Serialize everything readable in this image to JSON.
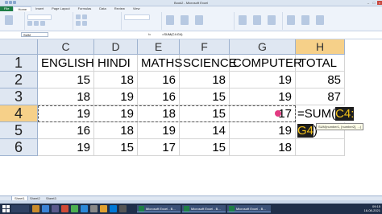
{
  "window": {
    "title": "Book2 - Microsoft Excel"
  },
  "ribbon": {
    "tabs": [
      "File",
      "Home",
      "Insert",
      "Page Layout",
      "Formulas",
      "Data",
      "Review",
      "View"
    ],
    "active_tab": "Home"
  },
  "formula_bar": {
    "name_box": "SUM",
    "fx": "fx",
    "formula": "=SUM(C4:G4)"
  },
  "grid": {
    "columns": [
      "C",
      "D",
      "E",
      "F",
      "G",
      "H"
    ],
    "selected_column": "H",
    "rows": [
      "1",
      "2",
      "3",
      "4",
      "5",
      "6"
    ],
    "selected_row": "4",
    "header_row": [
      "ENGLISH",
      "HINDI",
      "MATHS",
      "SCIENCE",
      "COMPUTER",
      "TOTAL"
    ],
    "data": [
      [
        "15",
        "18",
        "16",
        "18",
        "19",
        "85"
      ],
      [
        "18",
        "19",
        "16",
        "15",
        "19",
        "87"
      ],
      [
        "19",
        "19",
        "18",
        "15",
        "17",
        ""
      ],
      [
        "16",
        "18",
        "19",
        "14",
        "19",
        ""
      ],
      [
        "19",
        "15",
        "17",
        "15",
        "18",
        ""
      ]
    ]
  },
  "edit": {
    "prefix": "=SUM(",
    "ref_part1": "C4:",
    "ref_part2": "G4",
    "suffix": ")",
    "tooltip": "SUM(number1, [number2], ...)"
  },
  "sheets": [
    "Sheet1",
    "Sheet2",
    "Sheet3"
  ],
  "active_sheet": "Sheet1",
  "taskbar": {
    "apps": [
      "Microsoft Excel - B...",
      "Microsoft Excel - B...",
      "Microsoft Excel - B..."
    ],
    "time": "09:15",
    "date": "16-08-2021"
  },
  "colors": {
    "selected_header": "#f6d089",
    "header_bg": "#dfe7f2",
    "ref_highlight": "#1d1d1d",
    "ref_text": "#f4c31b",
    "pointer": "#e23b82"
  }
}
